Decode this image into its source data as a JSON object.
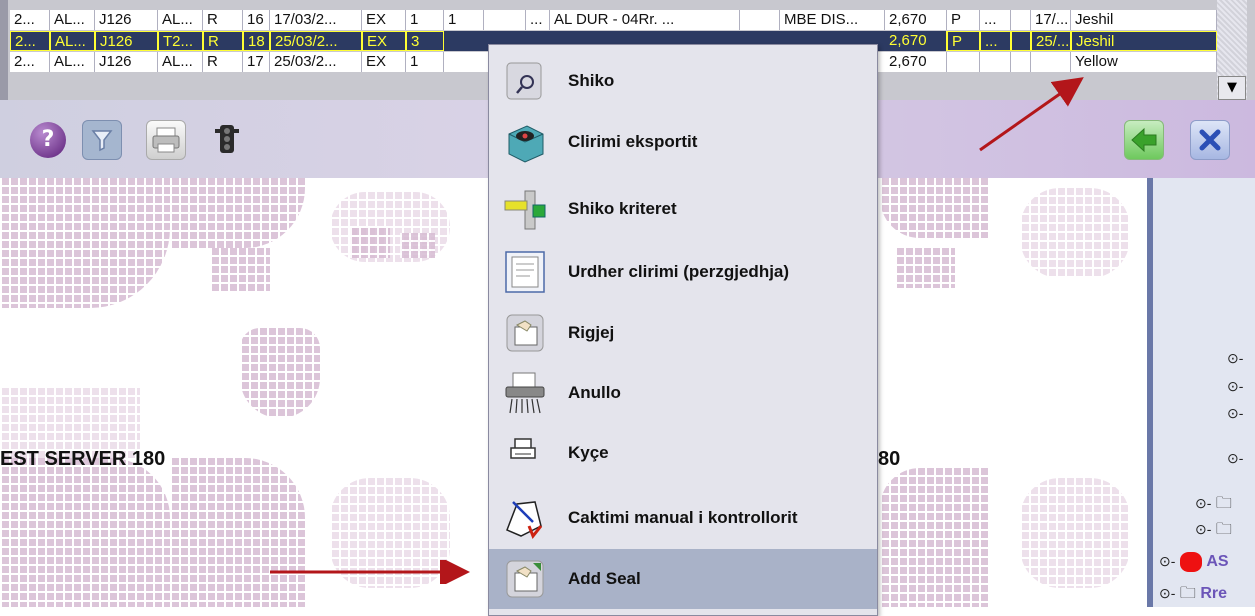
{
  "grid": {
    "rows": [
      {
        "cells": [
          "2...",
          "AL...",
          "J126",
          "AL...",
          "R",
          "16",
          "17/03/2...",
          "EX",
          "1",
          "1",
          "",
          "...",
          "AL DUR - 04Rr. ...",
          "",
          "MBE DIS...",
          "2,670",
          "P",
          "...",
          "",
          "17/...",
          "Jeshil"
        ]
      },
      {
        "cells": [
          "2...",
          "AL...",
          "J126",
          "T2...",
          "R",
          "18",
          "25/03/2...",
          "EX",
          "3",
          "",
          "",
          "",
          "",
          "",
          "",
          "2,670",
          "P",
          "...",
          "",
          "25/...",
          "Jeshil"
        ]
      },
      {
        "cells": [
          "2...",
          "AL...",
          "J126",
          "AL...",
          "R",
          "17",
          "25/03/2...",
          "EX",
          "1",
          "",
          "",
          "",
          "",
          "",
          "",
          "2,670",
          "",
          "",
          "",
          "",
          "Yellow"
        ]
      }
    ],
    "dropdown_icon": "triangle-down"
  },
  "toolbar": {
    "icons": [
      "help-icon",
      "filter-icon",
      "print-icon",
      "traffic-light-icon",
      "back-arrow-icon",
      "close-icon"
    ]
  },
  "map": {
    "server_label_left": "EST SERVER 180",
    "server_label_right": "80"
  },
  "tree": {
    "partial_label_1": "AS",
    "partial_label_2": "Rre"
  },
  "context_menu": {
    "items": [
      {
        "label": "Shiko",
        "icon": "view-icon"
      },
      {
        "label": "Clirimi eksportit",
        "icon": "export-release-icon"
      },
      {
        "label": "Shiko  kriteret",
        "icon": "criteria-icon"
      },
      {
        "label": "Urdher clirimi (perzgjedhja)",
        "icon": "release-order-icon"
      },
      {
        "label": "Rigjej",
        "icon": "refind-icon"
      },
      {
        "label": "Anullo",
        "icon": "shredder-icon"
      },
      {
        "label": "Kyçe",
        "icon": "lock-printer-icon"
      },
      {
        "label": "Caktimi manual i kontrollorit",
        "icon": "manual-assign-icon"
      },
      {
        "label": "Add Seal",
        "icon": "seal-icon",
        "highlighted": true
      }
    ]
  },
  "colors": {
    "selected_row_bg": "#2c3a62",
    "selected_row_text": "#ffff33",
    "arrow": "#b3161a",
    "menu_highlight": "#a9b2c8"
  }
}
